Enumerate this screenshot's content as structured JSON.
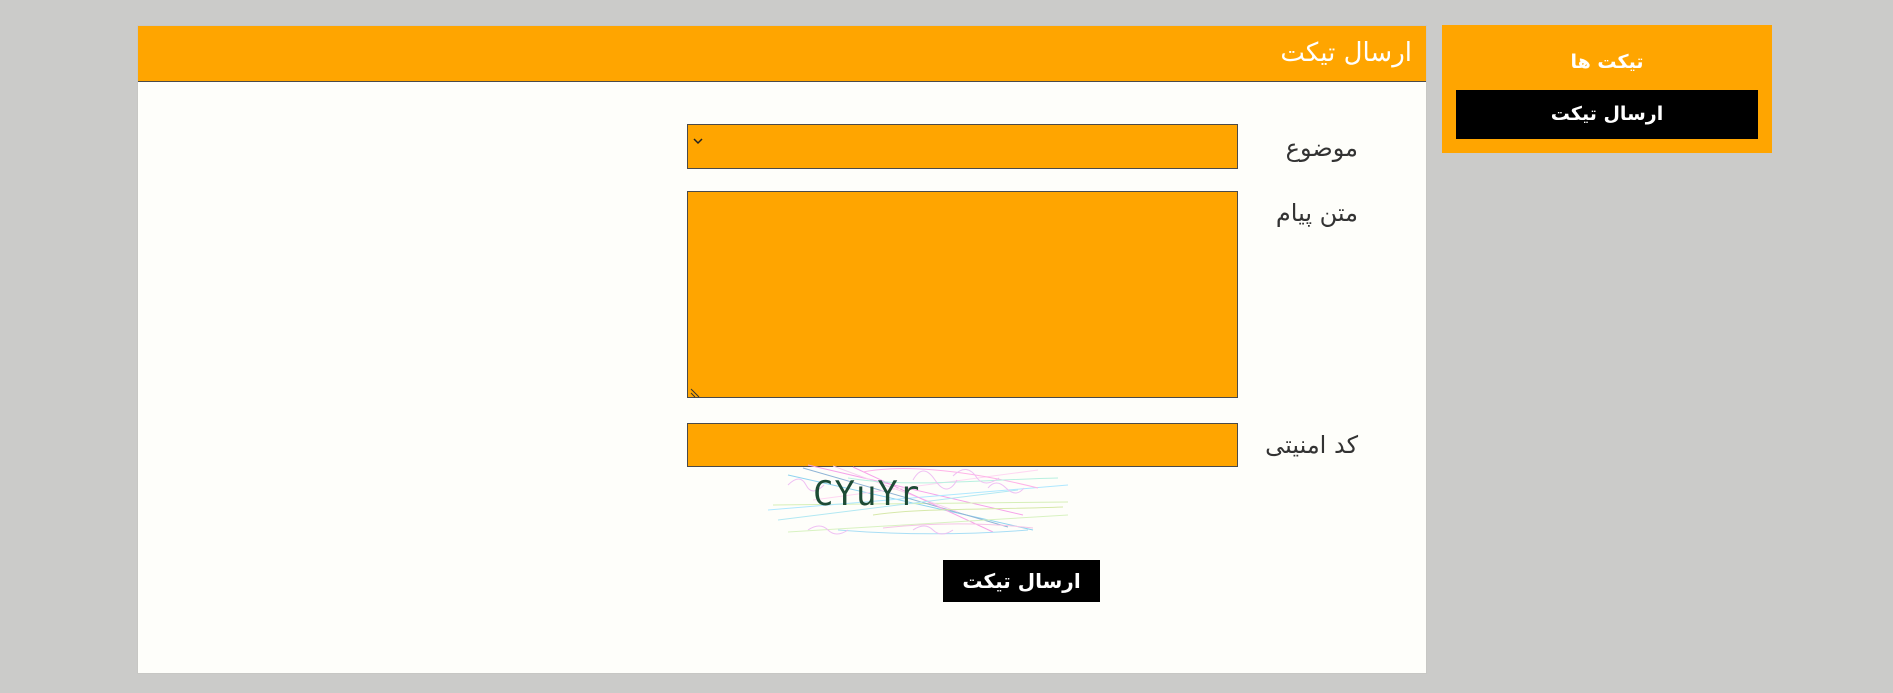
{
  "sidebar": {
    "title": "تیکت ها",
    "items": [
      {
        "label": "ارسال تیکت"
      }
    ]
  },
  "main": {
    "title": "ارسال تیکت",
    "form": {
      "subject": {
        "label": "موضوع",
        "value": ""
      },
      "message": {
        "label": "متن پیام",
        "value": ""
      },
      "security_code": {
        "label": "کد امنیتی",
        "value": ""
      },
      "captcha": {
        "text": "CYuYr"
      },
      "submit_label": "ارسال تیکت"
    }
  },
  "colors": {
    "accent": "#ffa500",
    "page_background": "#cbcbc9",
    "panel_background": "#fefefa",
    "button_background": "#000000",
    "button_text": "#ffffff"
  },
  "icons": {
    "select_arrow": "chevron-down-icon",
    "textarea_grip": "resize-grip-icon"
  }
}
